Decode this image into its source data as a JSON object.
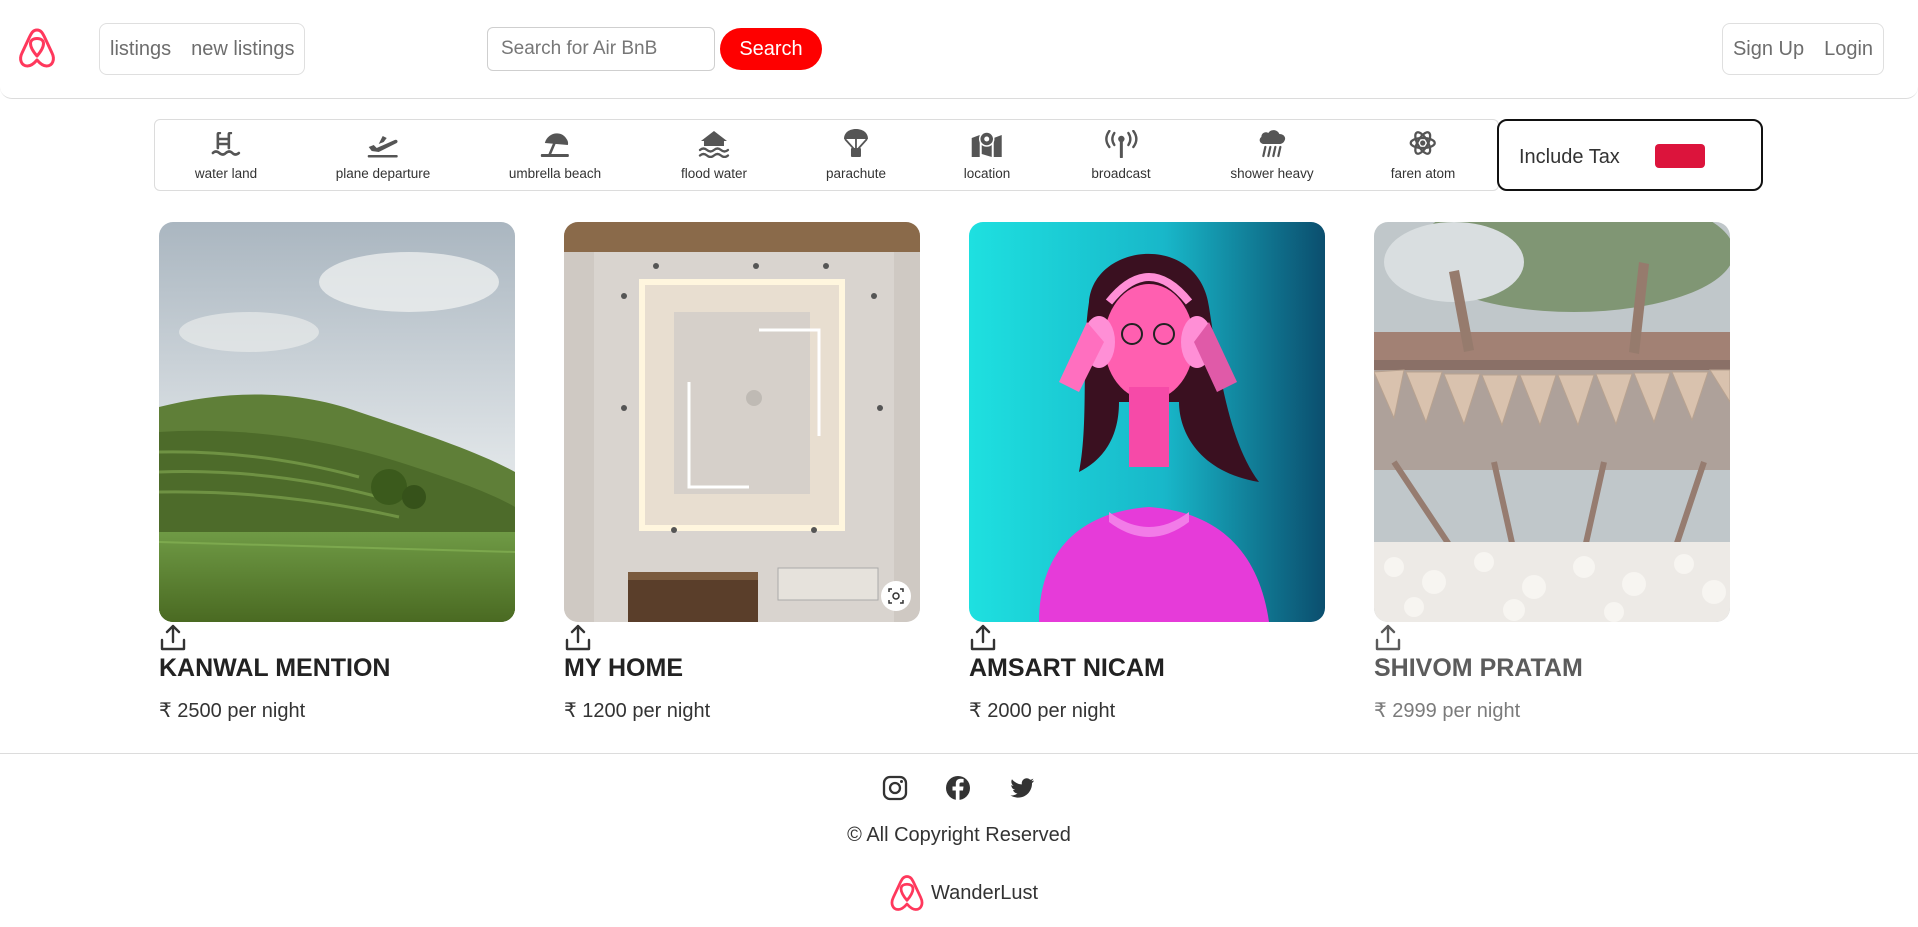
{
  "navbar": {
    "logo_icon": "airbnb-logo-icon",
    "links": [
      {
        "label": "listings"
      },
      {
        "label": "new listings"
      }
    ],
    "search": {
      "placeholder": "Search for Air BnB",
      "value": "",
      "button_label": "Search"
    },
    "auth": [
      {
        "label": "Sign Up"
      },
      {
        "label": "Login"
      }
    ]
  },
  "filters": [
    {
      "label": "water land",
      "icon": "water-ladder-icon"
    },
    {
      "label": "plane departure",
      "icon": "plane-departure-icon"
    },
    {
      "label": "umbrella beach",
      "icon": "umbrella-beach-icon"
    },
    {
      "label": "flood water",
      "icon": "house-flood-water-icon"
    },
    {
      "label": "parachute",
      "icon": "parachute-box-icon"
    },
    {
      "label": "location",
      "icon": "map-location-icon"
    },
    {
      "label": "broadcast",
      "icon": "tower-broadcast-icon"
    },
    {
      "label": "shower heavy",
      "icon": "cloud-showers-heavy-icon"
    },
    {
      "label": "faren atom",
      "icon": "atom-icon"
    }
  ],
  "tax_toggle": {
    "label": "Include Tax",
    "on": true,
    "color": "#dc143c"
  },
  "listings": [
    {
      "title": "KANWAL MENTION",
      "price": "₹ 2500 per night",
      "image": "hillside-terraces-photo"
    },
    {
      "title": "MY HOME",
      "price": "₹ 1200 per night",
      "image": "ceiling-interior-photo"
    },
    {
      "title": "AMSART NICAM",
      "price": "₹ 2000 per night",
      "image": "woman-headphones-neon-photo"
    },
    {
      "title": "SHIVOM PRATAM",
      "price": "₹ 2999 per night",
      "image": "god-bless-banner-photo"
    }
  ],
  "footer": {
    "social": [
      "instagram-icon",
      "facebook-icon",
      "twitter-icon"
    ],
    "copyright": "© All Copyright Reserved",
    "brand": "WanderLust"
  },
  "colors": {
    "accent": "#fe0000",
    "brand": "#ff385c",
    "toggle": "#dc143c"
  }
}
